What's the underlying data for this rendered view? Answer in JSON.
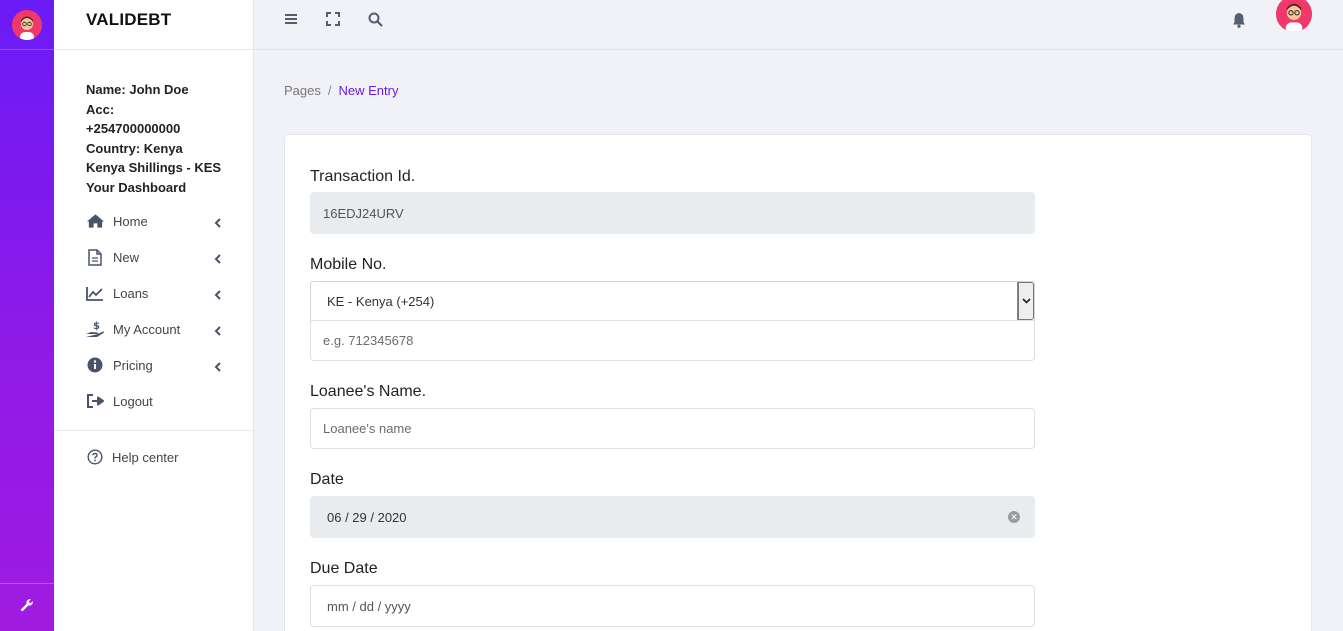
{
  "app": {
    "brand": "VALIDEBT"
  },
  "user": {
    "lines": [
      "Name: John Doe",
      "Acc:",
      "+254700000000",
      "Country: Kenya",
      "Kenya Shillings - KES",
      "Your Dashboard"
    ]
  },
  "sidebar": {
    "items": [
      {
        "label": "Home",
        "icon": "home-icon"
      },
      {
        "label": "New",
        "icon": "document-icon"
      },
      {
        "label": "Loans",
        "icon": "chart-line-icon"
      },
      {
        "label": "My Account",
        "icon": "hand-dollar-icon"
      },
      {
        "label": "Pricing",
        "icon": "info-circle-icon"
      },
      {
        "label": "Logout",
        "icon": "logout-icon"
      }
    ],
    "help_label": "Help center"
  },
  "breadcrumb": {
    "parent": "Pages",
    "separator": "/",
    "current": "New Entry"
  },
  "form": {
    "transaction_label": "Transaction Id.",
    "transaction_value": "16EDJ24URV",
    "mobile_label": "Mobile No.",
    "country_selected": "KE - Kenya (+254)",
    "mobile_placeholder": "e.g. 712345678",
    "loanee_label": "Loanee's Name.",
    "loanee_placeholder": "Loanee's name",
    "date_label": "Date",
    "date_value": "06 / 29 / 2020",
    "due_date_label": "Due Date",
    "due_date_placeholder": "mm / dd / yyyy"
  },
  "colors": {
    "accent": "#6a1be0",
    "rail_start": "#6a1bf5",
    "rail_end": "#a01be0"
  }
}
